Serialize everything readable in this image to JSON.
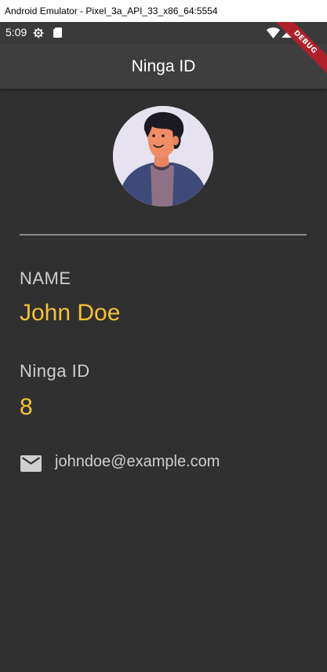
{
  "window": {
    "title": "Android Emulator - Pixel_3a_API_33_x86_64:5554"
  },
  "status_bar": {
    "time": "5:09",
    "icons": [
      "settings-gear-icon",
      "sd-card-icon",
      "wifi-icon",
      "cell-signal-icon"
    ]
  },
  "app_bar": {
    "title": "Ninga ID"
  },
  "debug_banner": {
    "label": "DEBUG",
    "color": "#b0202a"
  },
  "profile": {
    "avatar_icon": "person-avatar-illustration",
    "name_label": "NAME",
    "name_value": "John Doe",
    "id_label": "Ninga ID",
    "id_value": "8",
    "email_icon": "mail-icon",
    "email": "johndoe@example.com"
  },
  "colors": {
    "background": "#303030",
    "app_bar": "#3e3e3e",
    "accent": "#f6c13a",
    "label_text": "#cfcfcf",
    "avatar_background": "#e6e2ef"
  }
}
